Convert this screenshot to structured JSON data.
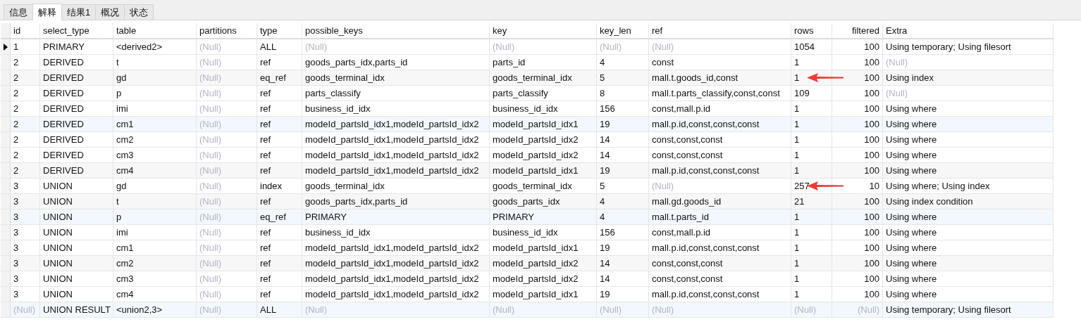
{
  "tabs": [
    {
      "label": "信息",
      "selected": false
    },
    {
      "label": "解释",
      "selected": true
    },
    {
      "label": "结果1",
      "selected": false
    },
    {
      "label": "概况",
      "selected": false
    },
    {
      "label": "状态",
      "selected": false
    }
  ],
  "table": {
    "columns": [
      {
        "label": "id",
        "numeric": false
      },
      {
        "label": "select_type",
        "numeric": false
      },
      {
        "label": "table",
        "numeric": false
      },
      {
        "label": "partitions",
        "numeric": false
      },
      {
        "label": "type",
        "numeric": false
      },
      {
        "label": "possible_keys",
        "numeric": false
      },
      {
        "label": "key",
        "numeric": false
      },
      {
        "label": "key_len",
        "numeric": false
      },
      {
        "label": "ref",
        "numeric": false
      },
      {
        "label": "rows",
        "numeric": false
      },
      {
        "label": "filtered",
        "numeric": true
      },
      {
        "label": "Extra",
        "numeric": false
      }
    ],
    "rows": [
      {
        "selected": true,
        "highlighted": false,
        "arrow": false,
        "cells": [
          "1",
          "PRIMARY",
          "<derived2>",
          {
            "text": "(Null)",
            "null": true
          },
          "ALL",
          {
            "text": "(Null)",
            "null": true
          },
          {
            "text": "(Null)",
            "null": true
          },
          {
            "text": "(Null)",
            "null": true
          },
          {
            "text": "(Null)",
            "null": true
          },
          "1054",
          "100",
          "Using temporary; Using filesort"
        ]
      },
      {
        "selected": false,
        "highlighted": false,
        "arrow": false,
        "cells": [
          "2",
          "DERIVED",
          "t",
          {
            "text": "(Null)",
            "null": true
          },
          "ref",
          "goods_parts_idx,parts_id",
          "parts_id",
          "4",
          "const",
          "1",
          "100",
          {
            "text": "(Null)",
            "null": true
          }
        ]
      },
      {
        "selected": false,
        "highlighted": false,
        "arrow": true,
        "cells": [
          "2",
          "DERIVED",
          "gd",
          {
            "text": "(Null)",
            "null": true
          },
          "eq_ref",
          "goods_terminal_idx",
          "goods_terminal_idx",
          "5",
          "mall.t.goods_id,const",
          "1",
          "100",
          "Using index"
        ]
      },
      {
        "selected": false,
        "highlighted": false,
        "arrow": false,
        "cells": [
          "2",
          "DERIVED",
          "p",
          {
            "text": "(Null)",
            "null": true
          },
          "ref",
          "parts_classify",
          "parts_classify",
          "8",
          "mall.t.parts_classify,const,const",
          "109",
          "100",
          {
            "text": "(Null)",
            "null": true
          }
        ]
      },
      {
        "selected": false,
        "highlighted": false,
        "arrow": false,
        "cells": [
          "2",
          "DERIVED",
          "imi",
          {
            "text": "(Null)",
            "null": true
          },
          "ref",
          "business_id_idx",
          "business_id_idx",
          "156",
          "const,mall.p.id",
          "1",
          "100",
          "Using where"
        ]
      },
      {
        "selected": false,
        "highlighted": true,
        "arrow": false,
        "cells": [
          "2",
          "DERIVED",
          "cm1",
          {
            "text": "(Null)",
            "null": true
          },
          "ref",
          "modeId_partsId_idx1,modeId_partsId_idx2",
          "modeId_partsId_idx1",
          "19",
          "mall.p.id,const,const,const",
          "1",
          "100",
          "Using where"
        ]
      },
      {
        "selected": false,
        "highlighted": false,
        "arrow": false,
        "cells": [
          "2",
          "DERIVED",
          "cm2",
          {
            "text": "(Null)",
            "null": true
          },
          "ref",
          "modeId_partsId_idx1,modeId_partsId_idx2",
          "modeId_partsId_idx2",
          "14",
          "const,const,const",
          "1",
          "100",
          "Using where"
        ]
      },
      {
        "selected": false,
        "highlighted": false,
        "arrow": false,
        "cells": [
          "2",
          "DERIVED",
          "cm3",
          {
            "text": "(Null)",
            "null": true
          },
          "ref",
          "modeId_partsId_idx1,modeId_partsId_idx2",
          "modeId_partsId_idx2",
          "14",
          "const,const,const",
          "1",
          "100",
          "Using where"
        ]
      },
      {
        "selected": false,
        "highlighted": false,
        "arrow": false,
        "cells": [
          "2",
          "DERIVED",
          "cm4",
          {
            "text": "(Null)",
            "null": true
          },
          "ref",
          "modeId_partsId_idx1,modeId_partsId_idx2",
          "modeId_partsId_idx1",
          "19",
          "mall.p.id,const,const,const",
          "1",
          "100",
          "Using where"
        ]
      },
      {
        "selected": false,
        "highlighted": false,
        "arrow": true,
        "cells": [
          "3",
          "UNION",
          "gd",
          {
            "text": "(Null)",
            "null": true
          },
          "index",
          "goods_terminal_idx",
          "goods_terminal_idx",
          "5",
          {
            "text": "(Null)",
            "null": true
          },
          "257",
          "10",
          "Using where; Using index"
        ]
      },
      {
        "selected": false,
        "highlighted": false,
        "arrow": false,
        "cells": [
          "3",
          "UNION",
          "t",
          {
            "text": "(Null)",
            "null": true
          },
          "ref",
          "goods_parts_idx,parts_id",
          "goods_parts_idx",
          "4",
          "mall.gd.goods_id",
          "21",
          "100",
          "Using index condition"
        ]
      },
      {
        "selected": false,
        "highlighted": true,
        "arrow": false,
        "cells": [
          "3",
          "UNION",
          "p",
          {
            "text": "(Null)",
            "null": true
          },
          "eq_ref",
          "PRIMARY",
          "PRIMARY",
          "4",
          "mall.t.parts_id",
          "1",
          "100",
          "Using where"
        ]
      },
      {
        "selected": false,
        "highlighted": false,
        "arrow": false,
        "cells": [
          "3",
          "UNION",
          "imi",
          {
            "text": "(Null)",
            "null": true
          },
          "ref",
          "business_id_idx",
          "business_id_idx",
          "156",
          "const,mall.p.id",
          "1",
          "100",
          "Using where"
        ]
      },
      {
        "selected": false,
        "highlighted": false,
        "arrow": false,
        "cells": [
          "3",
          "UNION",
          "cm1",
          {
            "text": "(Null)",
            "null": true
          },
          "ref",
          "modeId_partsId_idx1,modeId_partsId_idx2",
          "modeId_partsId_idx1",
          "19",
          "mall.p.id,const,const,const",
          "1",
          "100",
          "Using where"
        ]
      },
      {
        "selected": false,
        "highlighted": false,
        "arrow": false,
        "cells": [
          "3",
          "UNION",
          "cm2",
          {
            "text": "(Null)",
            "null": true
          },
          "ref",
          "modeId_partsId_idx1,modeId_partsId_idx2",
          "modeId_partsId_idx2",
          "14",
          "const,const,const",
          "1",
          "100",
          "Using where"
        ]
      },
      {
        "selected": false,
        "highlighted": false,
        "arrow": false,
        "cells": [
          "3",
          "UNION",
          "cm3",
          {
            "text": "(Null)",
            "null": true
          },
          "ref",
          "modeId_partsId_idx1,modeId_partsId_idx2",
          "modeId_partsId_idx2",
          "14",
          "const,const,const",
          "1",
          "100",
          "Using where"
        ]
      },
      {
        "selected": false,
        "highlighted": false,
        "arrow": false,
        "cells": [
          "3",
          "UNION",
          "cm4",
          {
            "text": "(Null)",
            "null": true
          },
          "ref",
          "modeId_partsId_idx1,modeId_partsId_idx2",
          "modeId_partsId_idx1",
          "19",
          "mall.p.id,const,const,const",
          "1",
          "100",
          "Using where"
        ]
      },
      {
        "selected": false,
        "highlighted": true,
        "arrow": false,
        "cells": [
          {
            "text": "(Null)",
            "null": true
          },
          "UNION RESULT",
          "<union2,3>",
          {
            "text": "(Null)",
            "null": true
          },
          "ALL",
          {
            "text": "(Null)",
            "null": true
          },
          {
            "text": "(Null)",
            "null": true
          },
          {
            "text": "(Null)",
            "null": true
          },
          {
            "text": "(Null)",
            "null": true
          },
          {
            "text": "(Null)",
            "null": true
          },
          {
            "text": "(Null)",
            "null": true
          },
          "Using temporary; Using filesort"
        ]
      }
    ]
  }
}
